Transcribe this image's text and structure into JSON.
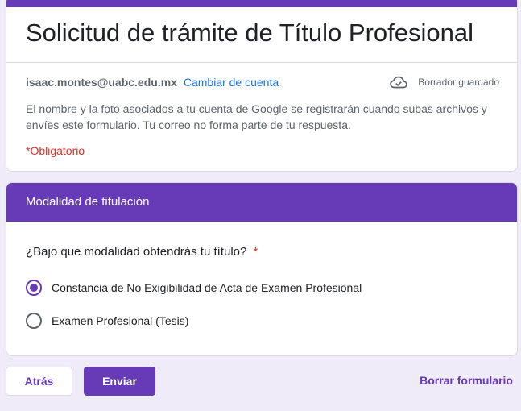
{
  "colors": {
    "accent": "#673ab7",
    "background": "#f0ebf8",
    "link": "#1a73e8",
    "required": "#d93025"
  },
  "header": {
    "title": "Solicitud de trámite de Título Profesional",
    "account_email": "isaac.montes@uabc.edu.mx",
    "switch_account": "Cambiar de cuenta",
    "draft_icon": "cloud-check-icon",
    "draft_status": "Borrador guardado",
    "notice": "El nombre y la foto asociados a tu cuenta de Google se registrarán cuando subas archivos y envíes este formulario. Tu correo no forma parte de tu respuesta.",
    "required_note": "*Obligatorio"
  },
  "section": {
    "title": "Modalidad de titulación",
    "question": "¿Bajo que modalidad obtendrás tu título?",
    "required_mark": "*",
    "options": [
      {
        "label": "Constancia de No Exigibilidad de Acta de Examen Profesional",
        "selected": true
      },
      {
        "label": "Examen Profesional (Tesis)",
        "selected": false
      }
    ]
  },
  "footer": {
    "back_label": "Atrás",
    "submit_label": "Enviar",
    "clear_label": "Borrar formulario"
  }
}
